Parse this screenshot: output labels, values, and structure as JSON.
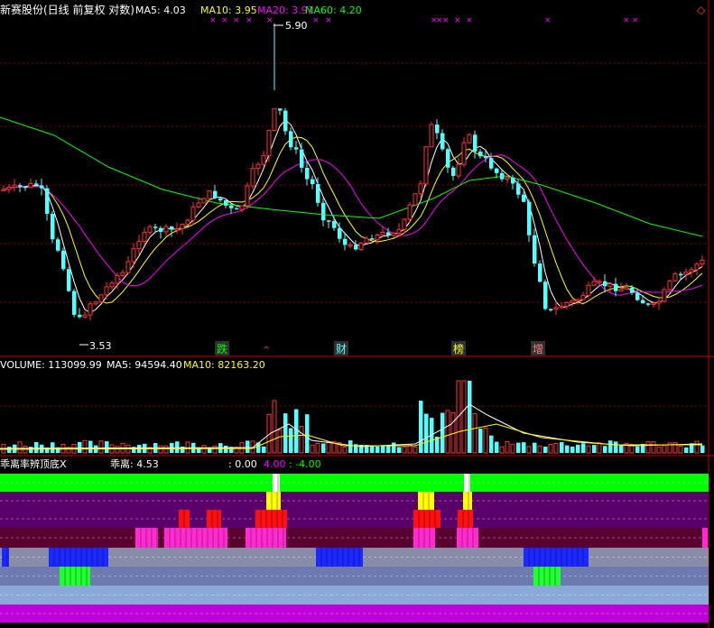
{
  "colors": {
    "background": "#000000",
    "up_candle": "#ff3232",
    "down_candle": "#54ffff",
    "ma5": "#ffffff",
    "ma10": "#ffff00",
    "ma20": "#ff00ff",
    "ma60": "#00ff00",
    "grid": "#8b0000",
    "panel_border": "#c00000"
  },
  "main_panel": {
    "title": "新赛股份(日线 前复权 对数)",
    "indicators": [
      {
        "label": "MA5: 4.03",
        "color": "#ffffff"
      },
      {
        "label": "MA10: 3.95",
        "color": "#ffff00"
      },
      {
        "label": "MA20: 3.91",
        "color": "#ff00ff"
      },
      {
        "label": "MA60: 4.20",
        "color": "#00ff00"
      }
    ],
    "high_label": "5.90",
    "low_label": "3.53",
    "event_markers": [
      {
        "text": "跌",
        "color": "#00ff00"
      },
      {
        "text": "财",
        "color": "#54ffff"
      },
      {
        "text": "榜",
        "color": "#ffff00"
      },
      {
        "text": "增",
        "color": "#ff8080"
      }
    ],
    "top_marks": "×"
  },
  "volume_panel": {
    "indicators": [
      {
        "label": "VOLUME: 113099.99",
        "color": "#ffffff"
      },
      {
        "label": "MA5: 94594.40",
        "color": "#ffffff"
      },
      {
        "label": "MA10: 82163.20",
        "color": "#ffff00"
      }
    ]
  },
  "indicator_panel": {
    "title": "乖离率辨顶底X",
    "value_label": "乖离: 4.53",
    "levels": [
      {
        "label": ": 0.00",
        "color": "#ffffff"
      },
      {
        "label": "4.00",
        "color": "#ff00ff"
      },
      {
        "label": ": -4.00",
        "color": "#00ff00"
      }
    ]
  },
  "ui": {
    "nav_icon": "◇",
    "top_marker_icon": "^"
  }
}
